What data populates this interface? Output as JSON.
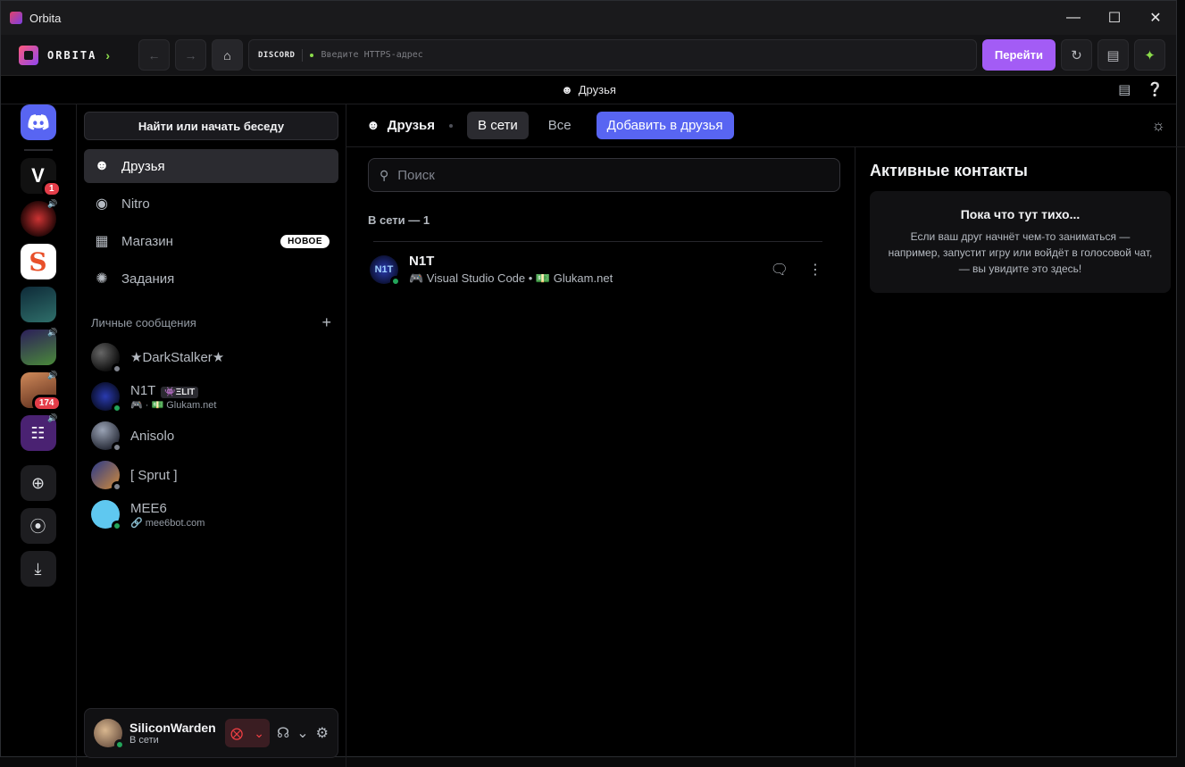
{
  "window": {
    "title": "Orbita"
  },
  "toolbar": {
    "brand": "ORBITA",
    "brand_chevron": "›",
    "back": "←",
    "forward": "→",
    "home": "⌂",
    "site_label": "DISCORD",
    "url_placeholder": "Введите HTTPS-адрес",
    "go_label": "Перейти",
    "reload": "↻",
    "reader": "▤",
    "spark": "✦"
  },
  "discord_top": {
    "title": "Друзья"
  },
  "guilds": [
    {
      "name": "home",
      "letter": "",
      "color": "#5865f2"
    },
    {
      "name": "vibe",
      "letter": "V",
      "color": "#1a1a1e",
      "badge": "1"
    },
    {
      "name": "club",
      "letter": "",
      "color": "#3a1010",
      "volume": true
    },
    {
      "name": "s-server",
      "letter": "S",
      "color": "#ffffff"
    },
    {
      "name": "laptop",
      "letter": "",
      "color": "#1b3340"
    },
    {
      "name": "pepe",
      "letter": "",
      "color": "#2a2050",
      "volume": true
    },
    {
      "name": "anime",
      "letter": "",
      "color": "#6b3a2a",
      "badge": "174",
      "volume": true
    },
    {
      "name": "monitor",
      "letter": "",
      "color": "#3a1a55",
      "volume": true
    }
  ],
  "sidebar": {
    "search_label": "Найти или начать беседу",
    "nav": [
      {
        "label": "Друзья",
        "icon": "friends-icon",
        "glyph": "☻"
      },
      {
        "label": "Nitro",
        "icon": "nitro-icon",
        "glyph": "◉"
      },
      {
        "label": "Магазин",
        "icon": "shop-icon",
        "glyph": "▦",
        "badge": "НОВОЕ"
      },
      {
        "label": "Задания",
        "icon": "quests-icon",
        "glyph": "✺"
      }
    ],
    "dm_header": "Личные сообщения",
    "dm_plus": "+",
    "dms": [
      {
        "name": "★DarkStalker★",
        "sub": "",
        "status": "offline",
        "color": "#222226"
      },
      {
        "name": "N1T",
        "tag": "👾ΞLIT",
        "sub": "🎮 · 💵 Glukam.net",
        "status": "online",
        "color": "#1a2a8a"
      },
      {
        "name": "Anisolo",
        "sub": "",
        "status": "offline",
        "color": "#5a6070"
      },
      {
        "name": "[ Sprut ]",
        "sub": "",
        "status": "offline",
        "color": "#3a4a8a"
      },
      {
        "name": "MEE6",
        "sub": "🔗 mee6bot.com",
        "status": "online",
        "color": "#4fc3f7"
      }
    ]
  },
  "user_panel": {
    "username": "SiliconWarden",
    "status": "В сети"
  },
  "content": {
    "title": "Друзья",
    "tabs": [
      "В сети",
      "Все"
    ],
    "add_friend": "Добавить в друзья",
    "search_placeholder": "Поиск",
    "online_count": "В сети — 1",
    "friends": [
      {
        "name": "N1T",
        "activity": "🎮 Visual Studio Code • 💵 Glukam.net",
        "avatar_text": "N1T"
      }
    ]
  },
  "active_now": {
    "title": "Активные контакты",
    "empty_title": "Пока что тут тихо...",
    "empty_desc": "Если ваш друг начнёт чем-то заниматься — например, запустит игру или войдёт в голосовой чат, — вы увидите это здесь!"
  }
}
